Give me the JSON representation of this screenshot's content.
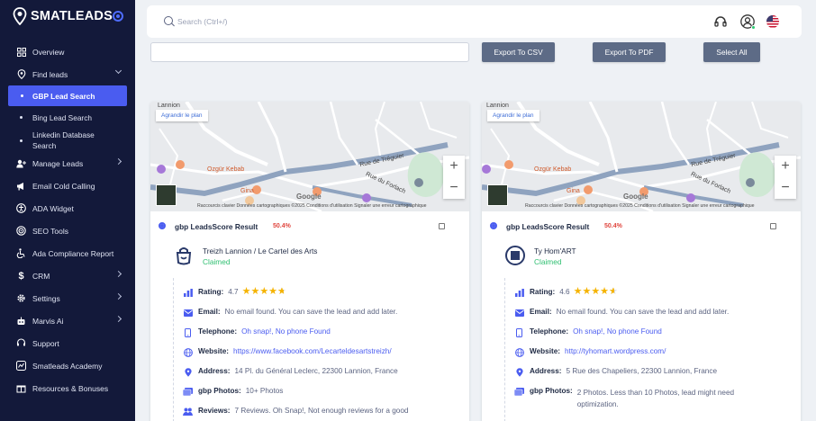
{
  "brand": {
    "name": "SMATLEADS"
  },
  "sidebar": {
    "items": [
      {
        "label": "Overview",
        "icon": "overview-icon"
      },
      {
        "label": "Find leads",
        "icon": "map-pin-icon"
      },
      {
        "label": "GBP Lead Search"
      },
      {
        "label": "Bing Lead Search"
      },
      {
        "label": "Linkedin Database Search"
      },
      {
        "label": "Manage Leads",
        "icon": "user-plus-icon"
      },
      {
        "label": "Email Cold Calling",
        "icon": "megaphone-icon"
      },
      {
        "label": "ADA Widget",
        "icon": "accessibility-icon"
      },
      {
        "label": "SEO Tools",
        "icon": "target-icon"
      },
      {
        "label": "Ada Compliance Report",
        "icon": "wheelchair-icon"
      },
      {
        "label": "CRM",
        "icon": "dollar-icon"
      },
      {
        "label": "Settings",
        "icon": "gear-icon"
      },
      {
        "label": "Marvis Ai",
        "icon": "robot-icon"
      },
      {
        "label": "Support",
        "icon": "headset-icon"
      },
      {
        "label": "Smatleads Academy",
        "icon": "academy-icon"
      },
      {
        "label": "Resources & Bonuses",
        "icon": "gift-icon"
      }
    ]
  },
  "topbar": {
    "search_placeholder": "Search (Ctrl+/)"
  },
  "toolbar": {
    "filter_value": "",
    "export_csv": "Export To CSV",
    "export_pdf": "Export To PDF",
    "select_all": "Select All"
  },
  "map_common": {
    "enlarge": "Agrandir le plan",
    "footer": "Raccourcis clavier    Données cartographiques ©2025    Conditions d'utilisation    Signaler une erreur cartographique",
    "google": "Google",
    "zoom_in": "+",
    "zoom_out": "−",
    "labels": [
      "Lannion",
      "Rue de Tréguier",
      "Ozgür Kebab",
      "Gina",
      "Rue du Forlach"
    ]
  },
  "colors": {
    "sidebar_bg": "#13193a",
    "accent": "#4a5cf0",
    "score": "#e0463e",
    "claimed": "#2fbf71",
    "star": "#f5b301"
  },
  "cards": [
    {
      "title": "gbp LeadsScore Result",
      "score": "50.4%",
      "name": "Treizh Lannion / Le Cartel des Arts",
      "status": "Claimed",
      "rating_label": "Rating:",
      "rating": "4.7",
      "stars": 4.7,
      "email_label": "Email:",
      "email": "No email found. You can save the lead and add later.",
      "telephone_label": "Telephone:",
      "telephone": "Oh snap!, No phone Found",
      "website_label": "Website:",
      "website": "https://www.facebook.com/Lecarteldesartstreizh/",
      "address_label": "Address:",
      "address": "14 Pl. du Général Leclerc, 22300 Lannion, France",
      "photos_label": "gbp Photos:",
      "photos": "10+ Photos",
      "reviews_label": "Reviews:",
      "reviews": "7 Reviews. Oh Snap!, Not enough reviews for a good"
    },
    {
      "title": "gbp LeadsScore Result",
      "score": "50.4%",
      "name": "Ty Hom'ART",
      "status": "Claimed",
      "rating_label": "Rating:",
      "rating": "4.6",
      "stars": 4.6,
      "email_label": "Email:",
      "email": "No email found. You can save the lead and add later.",
      "telephone_label": "Telephone:",
      "telephone": "Oh snap!, No phone Found",
      "website_label": "Website:",
      "website": "http://tyhomart.wordpress.com/",
      "address_label": "Address:",
      "address": "5 Rue des Chapeliers, 22300 Lannion, France",
      "photos_label": "gbp Photos:",
      "photos": "2 Photos. Less than 10 Photos, lead might need optimization."
    }
  ]
}
